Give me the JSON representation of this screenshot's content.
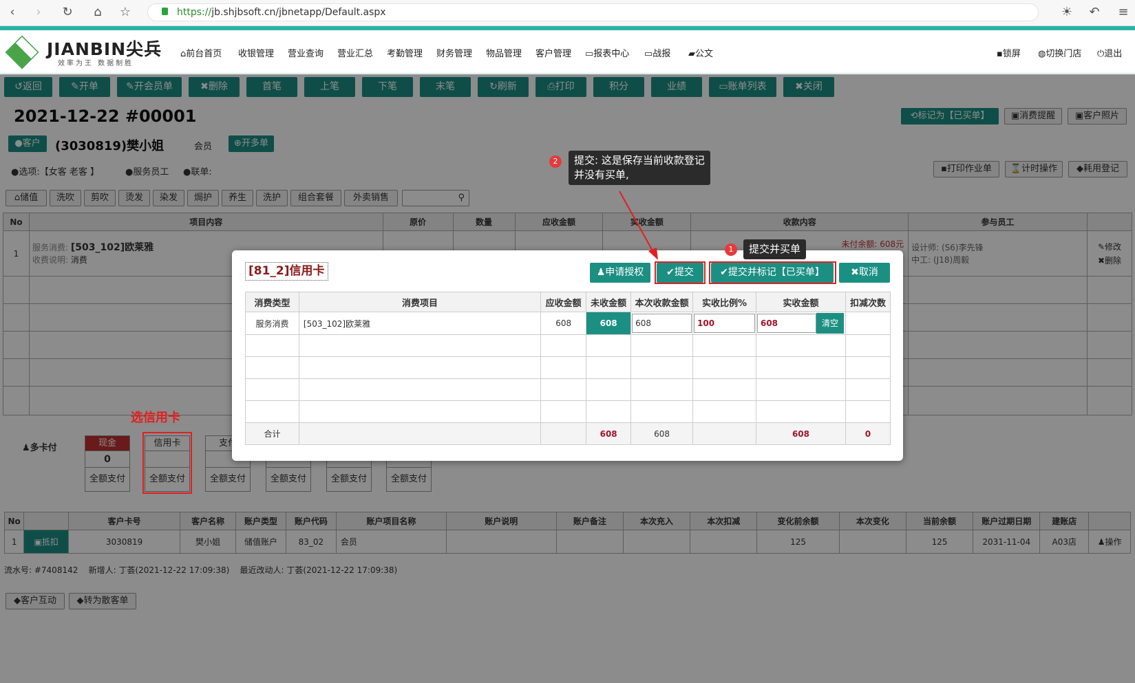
{
  "browser": {
    "url_scheme": "https://",
    "url_rest": "jb.shjbsoft.cn/jbnetapp/Default.aspx"
  },
  "app": {
    "logo_text": "JIANBIN尖兵",
    "logo_sub": "效率为王 数据制胜",
    "nav": [
      "前台首页",
      "收银管理",
      "营业查询",
      "营业汇总",
      "考勤管理",
      "财务管理",
      "物品管理",
      "客户管理",
      "报表中心",
      "战报",
      "公文"
    ],
    "right": [
      "锁屏",
      "切换门店",
      "退出"
    ]
  },
  "toolbar": [
    "返回",
    "开单",
    "开会员单",
    "删除",
    "首笔",
    "上笔",
    "下笔",
    "末笔",
    "刷新",
    "打印",
    "积分",
    "业绩",
    "账单列表",
    "关闭"
  ],
  "order": {
    "title": "2021-12-22  #00001",
    "mark_button": "标记为【已买单】",
    "remind_button": "消费提醒",
    "photo_button": "客户照片",
    "customer_button": "客户",
    "customer": "(3030819)樊小姐",
    "member": "会员",
    "multi_button": "开多单",
    "options": "选项:【女客 老客 】",
    "staff": "服务员工",
    "linked": "联单:",
    "print_work": "打印作业单",
    "timer": "计时操作",
    "consume_log": "耗用登记"
  },
  "service_tabs": [
    "储值",
    "洗吹",
    "剪吹",
    "烫发",
    "染发",
    "焗护",
    "养生",
    "洗护",
    "组合套餐",
    "外卖销售"
  ],
  "items_table": {
    "headers": [
      "No",
      "项目内容",
      "原价",
      "数量",
      "应收金额",
      "实收金额",
      "收款内容",
      "参与员工"
    ],
    "row": {
      "no": "1",
      "service_label": "服务消费:",
      "service": "[503_102]欧莱雅",
      "fee_label": "收费说明:",
      "fee": "消费",
      "unpaid": "未付余额: 608元",
      "designer_label": "设计师:",
      "designer": "(S6)李先锋",
      "worker_label": "中工:",
      "worker": "(J18)周毅",
      "edit": "修改",
      "delete": "删除"
    }
  },
  "annotations": {
    "choose_card": "选信用卡",
    "tip1": "提交并买单",
    "tip2_line1": "提交: 这是保存当前收款登记",
    "tip2_line2": "并没有买单,",
    "badge1": "1",
    "badge2": "2"
  },
  "payment": {
    "multi": "多卡付",
    "boxes": [
      {
        "name": "现金",
        "value": "0",
        "footer": "全额支付"
      },
      {
        "name": "信用卡",
        "value": "",
        "footer": "全额支付"
      },
      {
        "name": "支付",
        "value": "",
        "footer": "全额支付"
      },
      {
        "name": "",
        "value": "",
        "footer": "全额支付"
      },
      {
        "name": "",
        "value": "",
        "footer": "全额支付"
      },
      {
        "name": "",
        "value": "",
        "footer": "全额支付"
      }
    ]
  },
  "account_table": {
    "headers": [
      "No",
      "",
      "客户卡号",
      "客户名称",
      "账户类型",
      "账户代码",
      "账户项目名称",
      "账户说明",
      "账户备注",
      "本次充入",
      "本次扣减",
      "变化前余额",
      "本次变化",
      "当前余额",
      "账户过期日期",
      "建账店",
      ""
    ],
    "row": {
      "no": "1",
      "action": "抵扣",
      "card": "3030819",
      "name": "樊小姐",
      "type": "储值账户",
      "code": "83_02",
      "item": "会员",
      "before": "125",
      "current": "125",
      "expire": "2031-11-04",
      "store": "A03店",
      "op": "操作"
    }
  },
  "footer": {
    "info": "流水号: #7408142    新增人: 丁荟(2021-12-22 17:09:38)    最近改动人: 丁荟(2021-12-22 17:09:38)",
    "btn1": "客户互动",
    "btn2": "转为散客单"
  },
  "modal": {
    "title": "[81_2]信用卡",
    "btn_auth": "申请授权",
    "btn_submit": "提交",
    "btn_submit_mark": "提交并标记【已买单】",
    "btn_cancel": "取消",
    "headers": [
      "消费类型",
      "消费项目",
      "应收金额",
      "未收金额",
      "本次收款金额",
      "实收比例%",
      "实收金额",
      "扣减次数"
    ],
    "row": {
      "type": "服务消费",
      "item": "[503_102]欧莱雅",
      "due": "608",
      "unpaid": "608",
      "amount": "608",
      "ratio": "100",
      "actual": "608",
      "clear": "清空"
    },
    "total": {
      "label": "合计",
      "unpaid": "608",
      "amount": "608",
      "actual": "608",
      "count": "0"
    }
  }
}
